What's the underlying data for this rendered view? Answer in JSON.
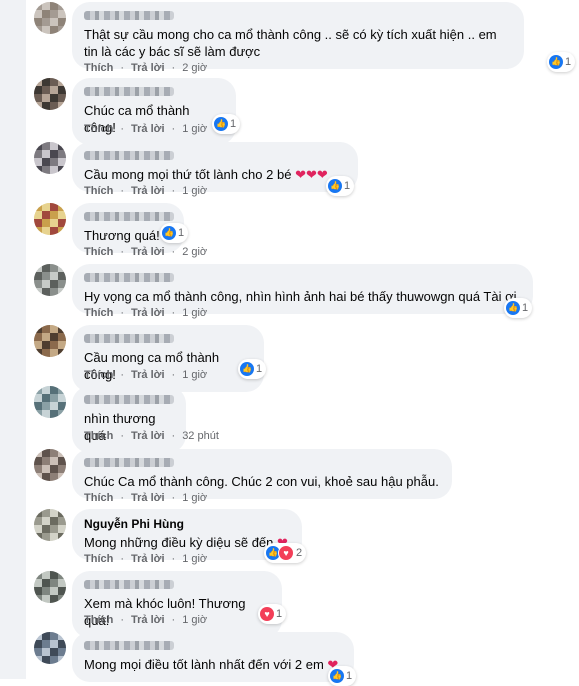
{
  "actions": {
    "like": "Thích",
    "reply": "Trả lời",
    "dot": "·"
  },
  "comments": [
    {
      "name": "",
      "text": "Thật sự cầu mong cho ca mổ thành công .. sẽ có kỳ tích xuất hiện .. em tin là các y bác sĩ sẽ làm được",
      "hearts": "",
      "time": "2 giờ",
      "reactions": [
        {
          "icon": "like-icon"
        }
      ],
      "count": "1"
    },
    {
      "name": "",
      "text": "Chúc ca mổ thành công!",
      "hearts": "",
      "time": "1 giờ",
      "reactions": [
        {
          "icon": "like-icon"
        }
      ],
      "count": "1"
    },
    {
      "name": "",
      "text": "Cầu mong mọi thứ tốt lành cho 2 bé",
      "hearts": "❤❤❤",
      "time": "1 giờ",
      "reactions": [
        {
          "icon": "like-icon"
        }
      ],
      "count": "1"
    },
    {
      "name": "",
      "text": "Thương quá!",
      "hearts": "",
      "time": "2 giờ",
      "reactions": [
        {
          "icon": "like-icon"
        }
      ],
      "count": "1"
    },
    {
      "name": "",
      "text": "Hy vọng ca mổ thành công, nhìn hình ảnh hai bé thấy thuwowgn quá Tài ơi",
      "hearts": "",
      "time": "1 giờ",
      "reactions": [
        {
          "icon": "like-icon"
        }
      ],
      "count": "1"
    },
    {
      "name": "",
      "text": "Cầu mong ca mổ thành công!",
      "hearts": "",
      "time": "1 giờ",
      "reactions": [
        {
          "icon": "like-icon"
        }
      ],
      "count": "1"
    },
    {
      "name": "",
      "text": "nhìn thương quá",
      "hearts": "",
      "time": "32 phút",
      "reactions": [],
      "count": ""
    },
    {
      "name": "",
      "text": "Chúc Ca mổ thành công. Chúc 2 con vui, khoẻ sau hậu phẫu.",
      "hearts": "",
      "time": "1 giờ",
      "reactions": [],
      "count": ""
    },
    {
      "name": "Nguyễn Phi Hùng",
      "text": "Mong những điều kỳ diệu sẽ đến",
      "hearts": "❤",
      "time": "1 giờ",
      "reactions": [
        {
          "icon": "like-icon"
        },
        {
          "icon": "love-icon"
        }
      ],
      "count": "2"
    },
    {
      "name": "",
      "text": "Xem mà khóc luôn! Thương quá!",
      "hearts": "",
      "time": "1 giờ",
      "reactions": [
        {
          "icon": "love-icon"
        }
      ],
      "count": "1"
    },
    {
      "name": "",
      "text": "Mong mọi điều tốt lành nhất đến với 2 em",
      "hearts": "❤",
      "time": "",
      "reactions": [
        {
          "icon": "like-icon"
        }
      ],
      "count": "1"
    }
  ]
}
